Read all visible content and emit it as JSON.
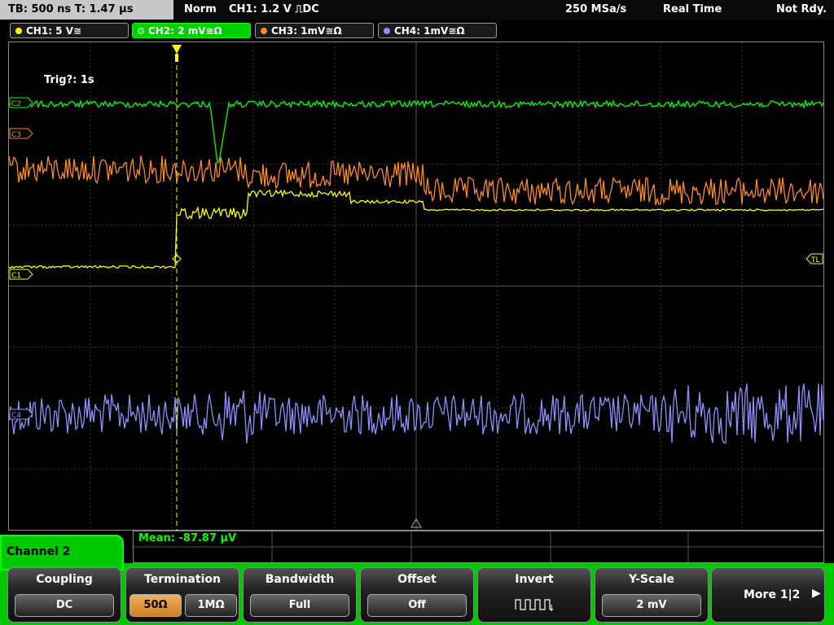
{
  "status_bar": {
    "timebase": "TB: 500 ns   T: 1.47 µs",
    "trigger_mode": "Norm",
    "trigger_info": "CH1: 1.2 V ⎍DC",
    "sample_rate": "250 MSa/s",
    "acquisition": "Real Time",
    "state": "Not Rdy."
  },
  "channel_tabs": [
    {
      "label": "CH1: 5 V≅",
      "color": "#ffff00"
    },
    {
      "label": "CH2: 2 mV≅Ω",
      "color": "#00ff00",
      "active": true
    },
    {
      "label": "CH3: 1mV≅Ω",
      "color": "#ff8a1e"
    },
    {
      "label": "CH4: 1mV≅Ω",
      "color": "#8f8fff"
    }
  ],
  "screen": {
    "trigger_text": "Trig?: 1s",
    "trigger_level_marker": "TL",
    "channel_markers": [
      "C2",
      "C3",
      "C1",
      "C4"
    ]
  },
  "measurement": {
    "mean": "Mean: -87.87 µV"
  },
  "side_menu": {
    "title": "Channel 2"
  },
  "softkeys": {
    "coupling": {
      "title": "Coupling",
      "value": "DC"
    },
    "termination": {
      "title": "Termination",
      "options": [
        "50Ω",
        "1MΩ"
      ],
      "selected": "50Ω"
    },
    "bandwidth": {
      "title": "Bandwidth",
      "value": "Full"
    },
    "offset": {
      "title": "Offset",
      "value": "Off"
    },
    "invert": {
      "title": "Invert",
      "icon": "invert-square-wave-icon"
    },
    "yscale": {
      "title": "Y-Scale",
      "value": "2 mV"
    },
    "more": {
      "label": "More 1|2"
    }
  },
  "colors": {
    "ch1": "#ffff00",
    "ch2": "#00ff00",
    "ch3": "#ff8a1e",
    "ch4": "#8f8fff",
    "menu_green": "#00c800"
  }
}
